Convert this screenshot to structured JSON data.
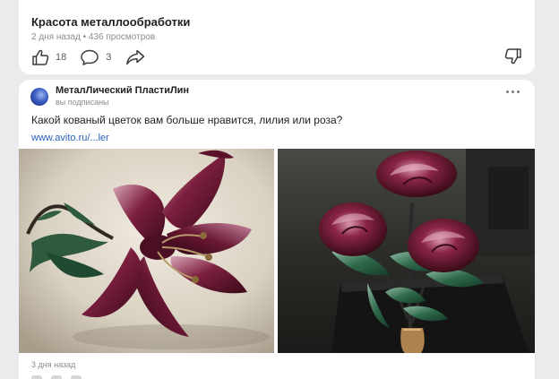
{
  "previous_post": {
    "title": "Красота металлообработки",
    "meta": "2 дня назад • 436 просмотров",
    "likes": "18",
    "comments": "3"
  },
  "post": {
    "channel_name": "МеталЛический ПластиЛин",
    "subscription_status": "вы подписаны",
    "text": "Какой кованый цветок вам больше нравится, лилия или роза?",
    "link": "www.avito.ru/...ler",
    "date": "3 дня назад",
    "photos": [
      "forged-lily-photo",
      "forged-roses-photo"
    ]
  },
  "icons": {
    "like": "thumbs-up-icon",
    "comment": "comment-bubble-icon",
    "share": "share-arrow-icon",
    "dislike": "thumbs-down-icon",
    "more": "more-dots-icon"
  }
}
